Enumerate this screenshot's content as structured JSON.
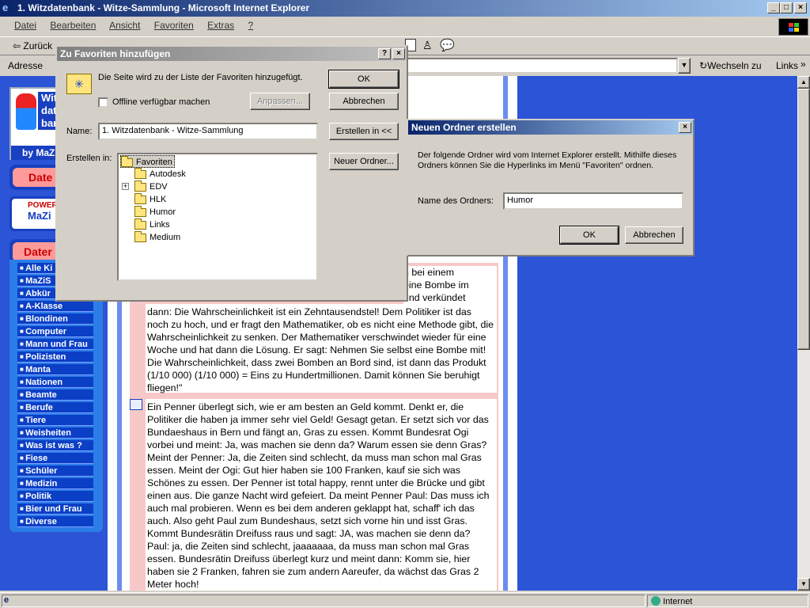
{
  "window": {
    "title": "1. Witzdatenbank - Witze-Sammlung - Microsoft Internet Explorer"
  },
  "menu": [
    "Datei",
    "Bearbeiten",
    "Ansicht",
    "Favoriten",
    "Extras",
    "?"
  ],
  "toolbar": {
    "back_label": "Zurück"
  },
  "address": {
    "label": "Adresse",
    "go_label": "Wechseln zu",
    "links_label": "Links"
  },
  "sidebar": {
    "logo_lines": [
      "Wit",
      "dat",
      "ban"
    ],
    "byline": "by MaZ",
    "tab1": "Date",
    "power_line1": "POWER",
    "power_line2": "MaZi",
    "tab2": "Dater",
    "items": [
      "Alle Ki",
      "MaZiS",
      "Abkür",
      "A-Klasse",
      "Blondinen",
      "Computer",
      "Mann und Frau",
      "Polizisten",
      "Manta",
      "Nationen",
      "Beamte",
      "Berufe",
      "Tiere",
      "Weisheiten",
      "Was ist was ?",
      "Fiese",
      "Schüler",
      "Medizin",
      "Politik",
      "Bier und Frau",
      "Diverse"
    ]
  },
  "content": {
    "joke1_partial": "h bei einem\neine Bombe im\n und verkündet",
    "joke1": "dann: Die Wahrscheinlichkeit ist ein Zehntausendstel! Dem Politiker ist das noch zu hoch, und er fragt den Mathematiker, ob es nicht eine Methode gibt, die Wahrscheinlichkeit zu senken. Der Mathematiker verschwindet wieder für eine Woche und hat dann die Lösung. Er sagt: Nehmen Sie selbst eine Bombe mit! Die Wahrscheinlichkeit, dass zwei Bomben an Bord sind, ist dann das Produkt (1/10 000) (1/10 000) = Eins zu Hundertmillionen. Damit können Sie beruhigt fliegen!\"",
    "joke2": "Ein Penner überlegt sich, wie er am besten an Geld kommt. Denkt er, die Politiker die haben ja immer sehr viel Geld! Gesagt getan. Er setzt sich vor das Bundaeshaus in Bern und fängt an, Gras zu essen. Kommt Bundesrat Ogi vorbei und meint: Ja, was machen sie denn da? Warum essen sie denn Gras? Meint der Penner: Ja, die Zeiten sind schlecht, da muss man schon mal Gras essen. Meint der Ogi: Gut hier haben sie 100 Franken, kauf sie sich was Schönes zu essen. Der Penner ist total happy, rennt unter die Brücke und gibt einen aus. Die ganze Nacht wird gefeiert. Da meint Penner Paul: Das muss ich auch mal probieren. Wenn es bei dem anderen geklappt hat, schaff' ich das auch. Also geht Paul zum Bundeshaus, setzt sich vorne hin und isst Gras. Kommt Bundesrätin Dreifuss raus und sagt: JA, was machen sie denn da? Paul: ja, die Zeiten sind schlecht, jaaaaaaa, da muss man schon mal Gras essen. Bundesrätin Dreifuss überlegt kurz und meint dann: Komm sie, hier haben sie 2 Franken, fahren sie zum andern Aareufer, da wächst das Gras 2 Meter hoch!"
  },
  "fav_dialog": {
    "title": "Zu Favoriten hinzufügen",
    "help": "?",
    "close": "×",
    "message": "Die Seite wird zu der Liste der Favoriten hinzugefügt.",
    "offline_label": "Offline verfügbar machen",
    "ok": "OK",
    "cancel": "Abbrechen",
    "customize": "Anpassen...",
    "name_label": "Name:",
    "name_value": "1. Witzdatenbank - Witze-Sammlung",
    "create_in_btn": "Erstellen in <<",
    "create_in_label": "Erstellen in:",
    "new_folder_btn": "Neuer Ordner...",
    "tree": [
      "Favoriten",
      "Autodesk",
      "EDV",
      "HLK",
      "Humor",
      "Links",
      "Medium"
    ]
  },
  "new_folder_dialog": {
    "title": "Neuen Ordner erstellen",
    "close": "×",
    "message": "Der folgende Ordner wird vom Internet Explorer erstellt. Mithilfe dieses Ordners können Sie die Hyperlinks im Menü \"Favoriten\" ordnen.",
    "name_label": "Name des Ordners:",
    "name_value": "Humor",
    "ok": "OK",
    "cancel": "Abbrechen"
  },
  "status": {
    "zone": "Internet"
  }
}
